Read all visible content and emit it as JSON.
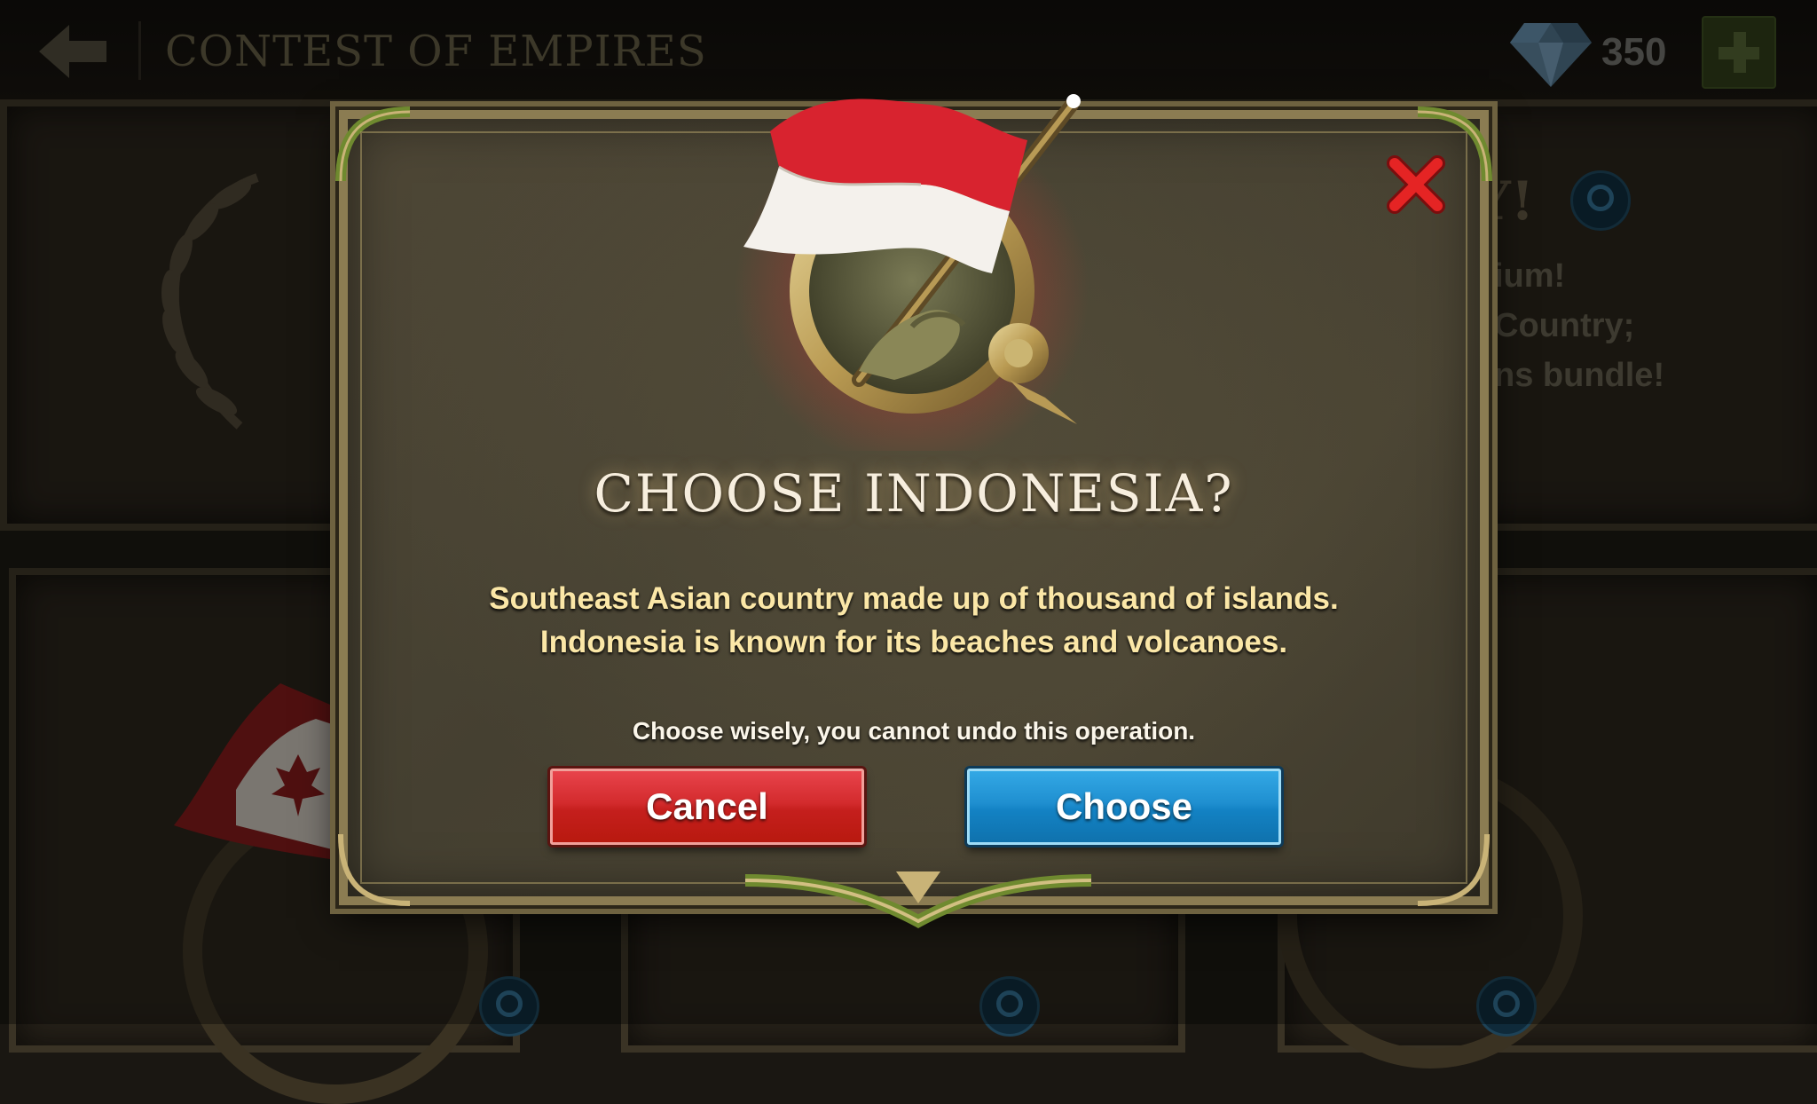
{
  "topbar": {
    "title": "CONTEST OF EMPIRES",
    "currency_icon": "diamond-icon",
    "currency_count": "350",
    "back_icon": "arrow-left-icon",
    "add_icon": "plus-icon"
  },
  "background": {
    "headline_fragment": "Y!",
    "lines": [
      "ium!",
      "Country;",
      "ns bundle!"
    ]
  },
  "dialog": {
    "emblem_icon": "indonesia-flag-emblem-icon",
    "close_icon": "close-icon",
    "title": "CHOOSE INDONESIA?",
    "description": "Southeast Asian country made up of thousand of islands. Indonesia is known for its beaches and volcanoes.",
    "warning": "Choose wisely, you cannot undo this operation.",
    "cancel_label": "Cancel",
    "choose_label": "Choose"
  },
  "colors": {
    "cancel_button": "#d32b2d",
    "choose_button": "#1f8fd0",
    "title_text": "#f7eede",
    "description_text": "#fbe7a7",
    "flag_red": "#d8232f",
    "flag_white": "#f4f1ec"
  }
}
